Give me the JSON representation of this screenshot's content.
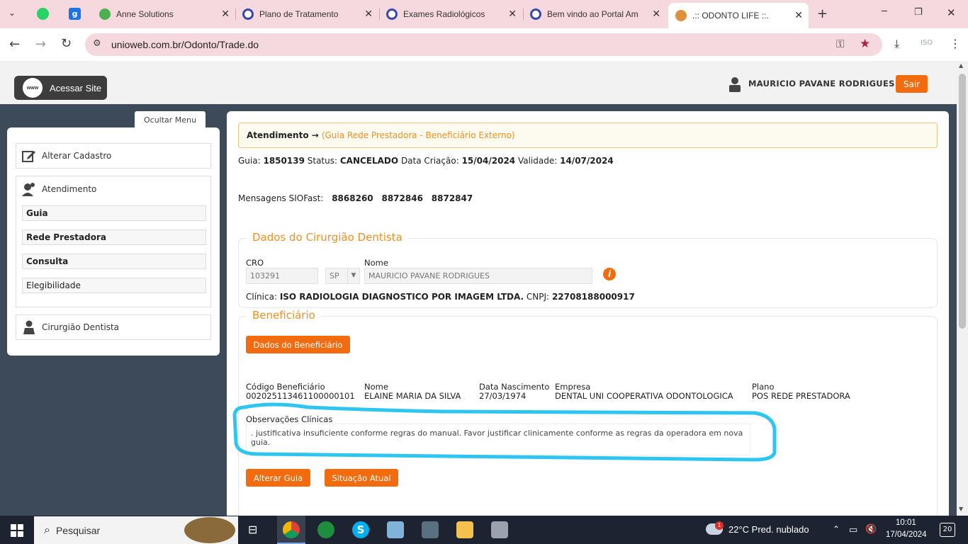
{
  "browser": {
    "tabs": [
      {
        "title": "Anne Solutions",
        "favicon_color": "#4caf50"
      },
      {
        "title": "Plano de Tratamento",
        "favicon_color": "#3949ab"
      },
      {
        "title": "Exames Radiológicos",
        "favicon_color": "#3949ab"
      },
      {
        "title": "Bem vindo ao Portal Am",
        "favicon_color": "#3949ab"
      },
      {
        "title": ".:: ODONTO LIFE ::.",
        "favicon_color": "#e0903a"
      }
    ],
    "new_tab": "+",
    "url": "unioweb.com.br/Odonto/Trade.do",
    "minimize": "─",
    "restore": "❐",
    "close": "✕"
  },
  "header": {
    "site_button": "Acessar Site",
    "www": "www",
    "user_name": "MAURICIO PAVANE RODRIGUES",
    "logout": "Sair"
  },
  "sidebar": {
    "toggle": "Ocultar Menu",
    "alterar_cadastro": "Alterar Cadastro",
    "atendimento": "Atendimento",
    "sub_items": [
      "Guia",
      "Rede Prestadora",
      "Consulta",
      "Elegibilidade"
    ],
    "cirurgiao": "Cirurgião Dentista"
  },
  "main": {
    "breadcrumb_title": "Atendimento →",
    "breadcrumb_sub": "(Guia Rede Prestadora - Beneficiário Externo)",
    "guia_label": "Guia:",
    "guia_value": "1850139",
    "status_label": "Status:",
    "status_value": "CANCELADO",
    "criacao_label": "Data Criação:",
    "criacao_value": "15/04/2024",
    "validade_label": "Validade:",
    "validade_value": "14/07/2024",
    "mensagens_label": "Mensagens SIOFast:",
    "mensagens": [
      "8868260",
      "8872846",
      "8872847"
    ],
    "dentista": {
      "legend": "Dados do Cirurgião Dentista",
      "cro_label": "CRO",
      "cro_value": "103291",
      "uf_value": "SP",
      "nome_label": "Nome",
      "nome_value": "MAURICIO PAVANE RODRIGUES",
      "clinica_label": "Clínica:",
      "clinica_value": "ISO RADIOLOGIA DIAGNOSTICO POR IMAGEM LTDA.",
      "cnpj_label": "CNPJ:",
      "cnpj_value": "22708188000917"
    },
    "beneficiario": {
      "legend": "Beneficiário",
      "button": "Dados do Beneficiário",
      "codigo_label": "Código Beneficiário",
      "codigo_value": "00202511346110000010​1",
      "nome_label": "Nome",
      "nome_value": "ELAINE MARIA DA SILVA",
      "nasc_label": "Data Nascimento",
      "nasc_value": "27/03/1974",
      "empresa_label": "Empresa",
      "empresa_value": "DENTAL UNI COOPERATIVA ODONTOLOGICA",
      "plano_label": "Plano",
      "plano_value": "POS REDE PRESTADORA",
      "obs_label": "Observações Clínicas",
      "obs_value": ". justificativa insuficiente conforme regras do manual. Favor justificar clinicamente conforme as regras da operadora em nova guia."
    },
    "alterar_guia": "Alterar Guia",
    "situacao_atual": "Situação Atual"
  },
  "taskbar": {
    "search": "Pesquisar",
    "weather": "22°C  Pred. nublado",
    "weather_badge": "1",
    "time": "10:01",
    "date": "17/04/2024",
    "notifications": "20"
  },
  "colors": {
    "accent_orange": "#f26b0f",
    "annotation_blue": "#2ec5f0",
    "page_bg": "#3d4a59"
  }
}
